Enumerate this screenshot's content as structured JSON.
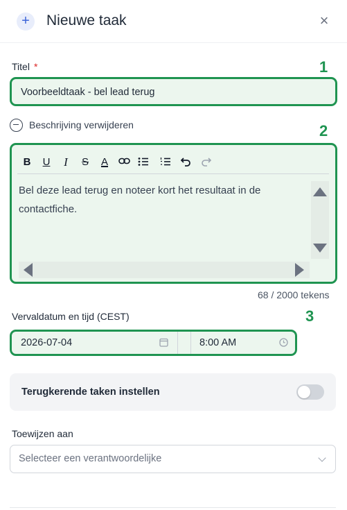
{
  "header": {
    "plus_icon": "+",
    "title": "Nieuwe taak",
    "close_icon": "×"
  },
  "title_field": {
    "label": "Titel",
    "required_mark": "*",
    "value": "Voorbeeldtaak - bel lead terug",
    "annotation": "1"
  },
  "description": {
    "toggle_label": "Beschrijving verwijderen",
    "annotation": "2",
    "toolbar": {
      "bold": "B",
      "underline": "U",
      "italic": "I",
      "strikethrough": "S",
      "text_color": "A"
    },
    "text": "Bel deze lead terug en noteer kort het resultaat in de contactfiche.",
    "token_count": "68 / 2000 tekens"
  },
  "due": {
    "label": "Vervaldatum en tijd (CEST)",
    "annotation": "3",
    "date_value": "2026-07-04",
    "time_value": "8:00 AM"
  },
  "recurring": {
    "label": "Terugkerende taken instellen",
    "enabled": false
  },
  "assign": {
    "label": "Toewijzen aan",
    "placeholder": "Selecteer een verantwoordelijke"
  },
  "colors": {
    "annotation_green": "#1f9451",
    "highlight_fill": "#ecf6ee",
    "required_red": "#dc2626",
    "accent_blue": "#3b63d8"
  }
}
